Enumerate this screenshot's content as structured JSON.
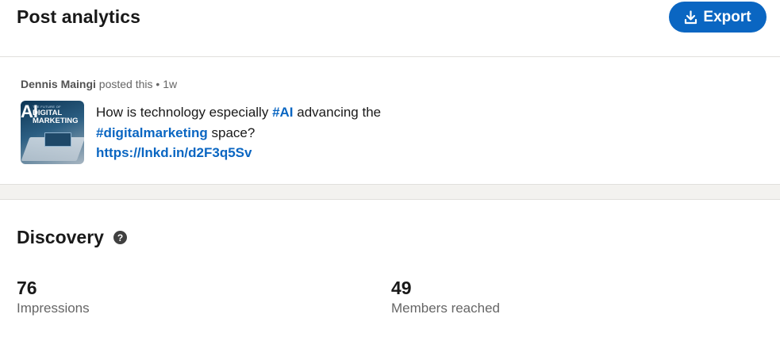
{
  "header": {
    "title": "Post analytics",
    "export_label": "Export"
  },
  "post": {
    "author": "Dennis Maingi",
    "action": "posted this",
    "separator": "•",
    "time": "1w",
    "thumbnail": {
      "badge": "AI",
      "small_text": "THE FUTURE OF",
      "line1": "DIGITAL",
      "line2": "MARKETING"
    },
    "text_part1": "How is technology especially ",
    "hashtag1": "#AI",
    "text_part2": " advancing the ",
    "hashtag2": "#digitalmarketing",
    "text_part3": " space?",
    "link": "https://lnkd.in/d2F3q5Sv"
  },
  "discovery": {
    "title": "Discovery",
    "help_icon": "question-circle-icon",
    "metrics": [
      {
        "value": "76",
        "label": "Impressions"
      },
      {
        "value": "49",
        "label": "Members reached"
      }
    ]
  },
  "colors": {
    "accent": "#0a66c2",
    "text": "#191919",
    "muted": "#666666",
    "band": "#f3f2ef"
  }
}
